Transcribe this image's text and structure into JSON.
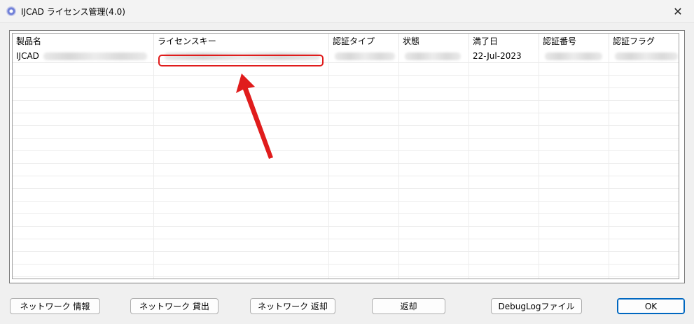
{
  "window": {
    "title": "IJCAD ライセンス管理(4.0)",
    "close_glyph": "✕"
  },
  "table": {
    "columns": [
      "製品名",
      "ライセンスキー",
      "認証タイプ",
      "状態",
      "満了日",
      "認証番号",
      "認証フラグ"
    ],
    "rows": [
      {
        "product": "IJCAD",
        "license_key": "",
        "auth_type": "",
        "status": "",
        "expiry": "22-Jul-2023",
        "auth_number": "",
        "auth_flag": ""
      }
    ]
  },
  "buttons": {
    "network_info": "ネットワーク 情報",
    "network_lend": "ネットワーク 貸出",
    "network_return": "ネットワーク 返却",
    "return": "返却",
    "debug_log": "DebugLogファイル",
    "ok": "OK"
  },
  "colors": {
    "annotation": "#e01c1c",
    "default_button_border": "#0067c0"
  }
}
